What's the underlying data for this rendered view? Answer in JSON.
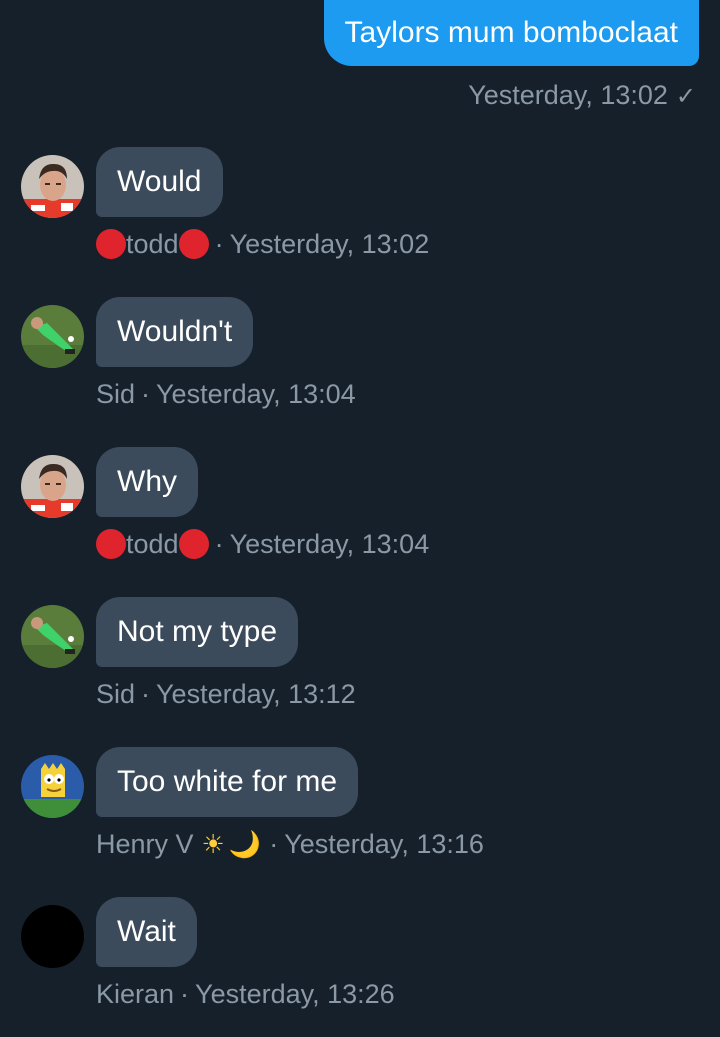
{
  "outgoing": {
    "text": "Taylors mum bomboclaat",
    "timestamp": "Yesterday, 13:02",
    "status_icon": "check-icon",
    "status_glyph": "✓",
    "color": "#1d9bf0"
  },
  "messages": [
    {
      "text": "Would",
      "sender": "todd",
      "timestamp": "Yesterday, 13:02",
      "avatar": "racing-driver-avatar"
    },
    {
      "text": "Wouldn't",
      "sender": "Sid",
      "timestamp": "Yesterday, 13:04",
      "avatar": "goalkeeper-avatar"
    },
    {
      "text": "Why",
      "sender": "todd",
      "timestamp": "Yesterday, 13:04",
      "avatar": "racing-driver-avatar"
    },
    {
      "text": "Not my type",
      "sender": "Sid",
      "timestamp": "Yesterday, 13:12",
      "avatar": "goalkeeper-avatar"
    },
    {
      "text": "Too white for me",
      "sender": "Henry V",
      "timestamp": "Yesterday, 13:16",
      "avatar": "cartoon-avatar"
    },
    {
      "text": "Wait",
      "sender": "Kieran",
      "timestamp": "Yesterday, 13:26",
      "avatar": "black-avatar"
    }
  ],
  "separator": "·",
  "glyphs": {
    "sun": "☀",
    "moon": "🌙"
  },
  "colors": {
    "background": "#15202b",
    "incoming_bubble": "#3b4b5b",
    "meta_text": "#8b98a5",
    "red_dot": "#e0242e"
  }
}
